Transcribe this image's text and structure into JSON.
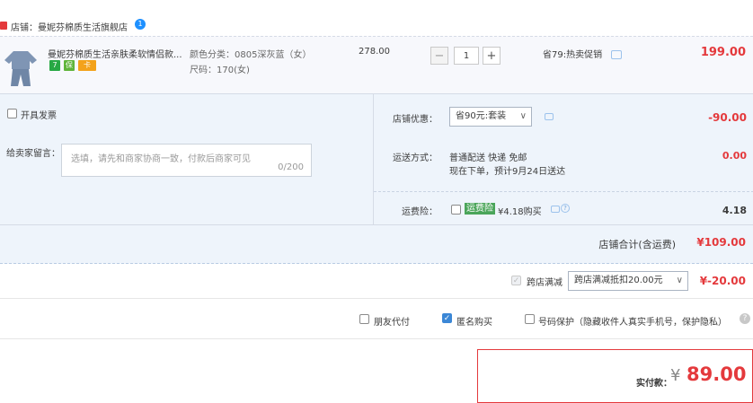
{
  "shop": {
    "label": "店铺：曼妮芬棉质生活旗舰店",
    "wangwang_badge": "1"
  },
  "item": {
    "title": "曼妮芬棉质生活亲肤柔软情侣款...",
    "badges": [
      "7",
      "保",
      "卡"
    ],
    "spec_color": "颜色分类：0805深灰蓝（女）",
    "spec_size": "尺码：170(女)",
    "unit_price": "278.00",
    "quantity": "1",
    "minus": "−",
    "plus": "+",
    "promo": "省79:热卖促销",
    "subtotal": "199.00"
  },
  "invoice": {
    "label": "开具发票"
  },
  "message": {
    "label": "给卖家留言：",
    "placeholder": "选填，请先和商家协商一致，付款后商家可见",
    "counter": "0/200"
  },
  "store_discount": {
    "label": "店铺优惠：",
    "selected": "省90元:套装",
    "amount": "-90.00"
  },
  "shipping": {
    "label": "运送方式：",
    "method": "普通配送 快递 免邮",
    "eta": "现在下单，预计9月24日送达",
    "amount": "0.00"
  },
  "freight_insurance": {
    "label": "运费险：",
    "tag": "运费险",
    "price_text": "¥4.18购买",
    "amount": "4.18"
  },
  "shop_total": {
    "label": "店铺合计(含运费)",
    "amount": "¥109.00"
  },
  "cross_store": {
    "label": "跨店满减",
    "selected": "跨店满减抵扣20.00元",
    "amount": "¥-20.00"
  },
  "options": {
    "friend_pay": "朋友代付",
    "anonymous": "匿名购买",
    "number_protect": "号码保护（隐藏收件人真实手机号，保护隐私）"
  },
  "payment": {
    "label": "实付款：",
    "currency": "¥",
    "amount": "89.00"
  },
  "colors": {
    "accent_red": "#e4393c",
    "panel_bg": "#eef4fb",
    "row_bg": "#f7f8fc",
    "checkbox_blue": "#3b87d6"
  }
}
